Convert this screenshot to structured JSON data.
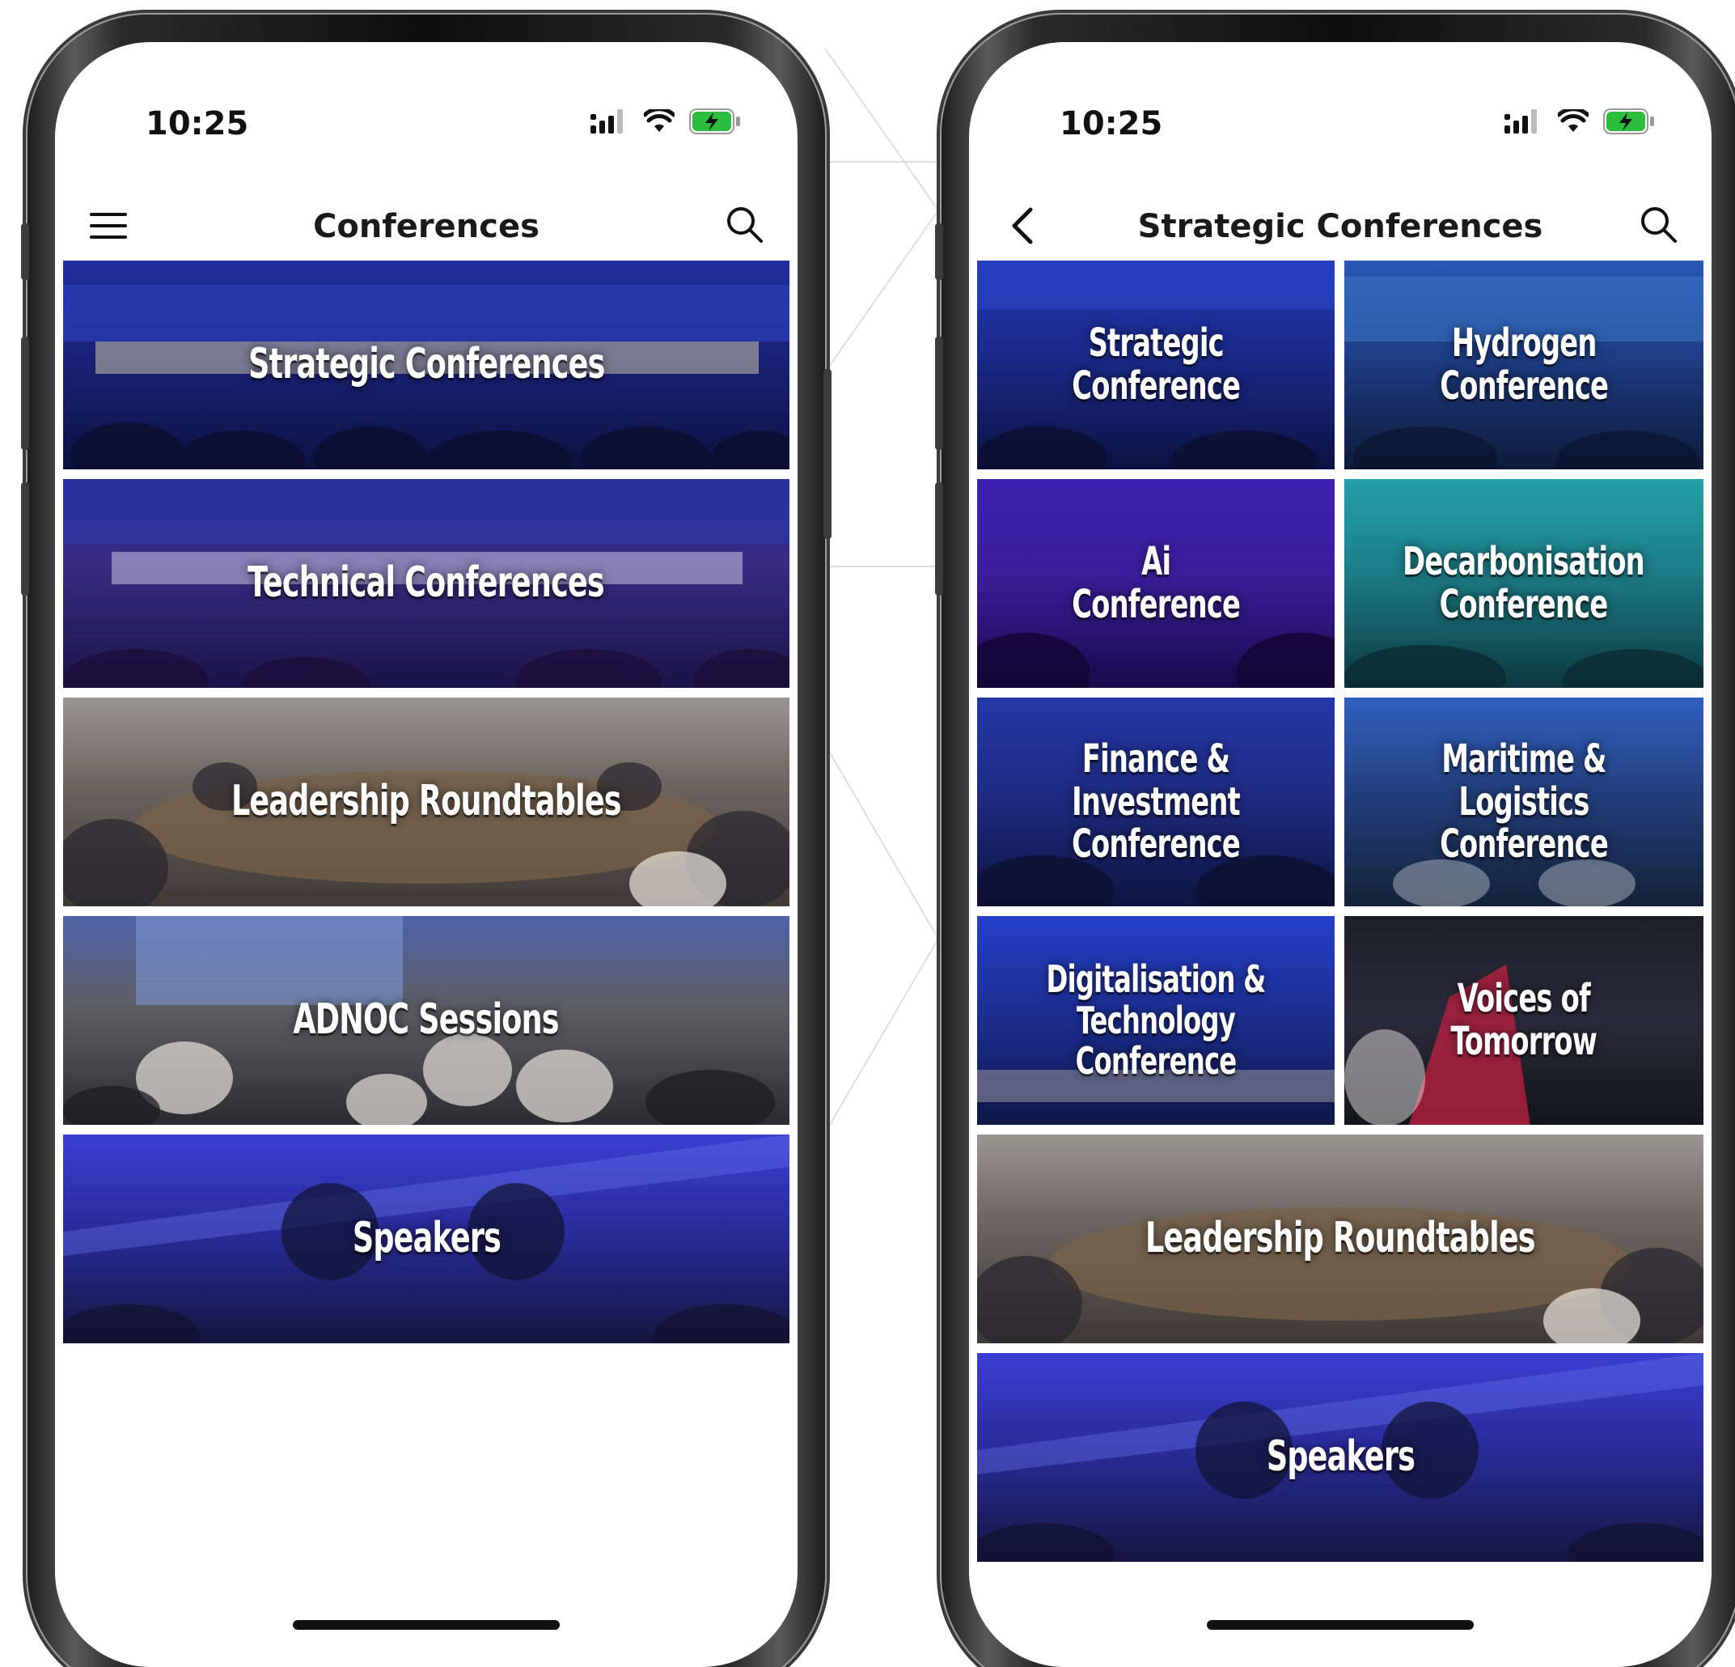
{
  "left_phone": {
    "status": {
      "time": "10:25"
    },
    "navbar": {
      "title": "Conferences",
      "left_icon": "hamburger-menu-icon",
      "right_icon": "search-icon"
    },
    "tiles": [
      {
        "label": "Strategic Conferences",
        "theme": "#1e2a8a"
      },
      {
        "label": "Technical Conferences",
        "theme": "#2a1f6e"
      },
      {
        "label": "Leadership Roundtables",
        "theme": "#5a5148"
      },
      {
        "label": "ADNOC Sessions",
        "theme": "#4b4d55"
      },
      {
        "label": "Speakers",
        "theme": "#25298a"
      }
    ]
  },
  "right_phone": {
    "status": {
      "time": "10:25"
    },
    "navbar": {
      "title": "Strategic Conferences",
      "left_icon": "back-chevron-icon",
      "right_icon": "search-icon"
    },
    "grid_tiles": [
      {
        "label_line1": "Strategic",
        "label_line2": "Conference",
        "theme": "#1e2a8a"
      },
      {
        "label_line1": "Hydrogen",
        "label_line2": "Conference",
        "theme": "#1d3f86"
      },
      {
        "label_line1": "Ai",
        "label_line2": "Conference",
        "theme": "#3a1d9a"
      },
      {
        "label_line1": "Decarbonisation",
        "label_line2": "Conference",
        "theme": "#1c7c86"
      },
      {
        "label_line1": "Finance & Investment",
        "label_line2": "Conference",
        "theme": "#1f2c84"
      },
      {
        "label_line1": "Maritime & Logistics",
        "label_line2": "Conference",
        "theme": "#23407e"
      },
      {
        "label_line1": "Digitalisation &",
        "label_line2": "Technology Conference",
        "theme": "#1d2f94"
      },
      {
        "label_line1": "Voices of",
        "label_line2": "Tomorrow",
        "theme": "#2b2a3a"
      }
    ],
    "wide_tiles": [
      {
        "label": "Leadership Roundtables",
        "theme": "#5a5148"
      },
      {
        "label": "Speakers",
        "theme": "#25298a"
      }
    ]
  },
  "colors": {
    "battery_green": "#2dbd3c",
    "text_dark": "#1a1a1a"
  }
}
